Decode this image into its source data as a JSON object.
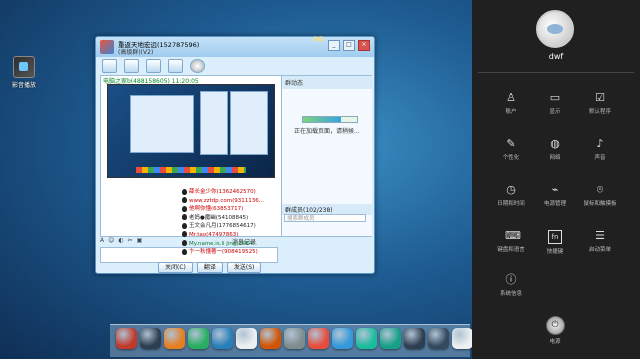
{
  "desktop": {
    "icon_label": "影音播放"
  },
  "chat": {
    "title": "重返天地宏远(152787596)",
    "subtitle": "(高级群)(V2)",
    "qq_badge": "QQ",
    "message_header": "电脑之家b(488158605)  11:20:05",
    "group_header": "群动态",
    "loading_text": "正在加载页面，请稍候...",
    "members_header": "群成员(102/238)",
    "members_search_placeholder": "搜索群成员",
    "members": [
      "薛长金少你(1362462570)",
      "www.zztdp.com(9311136...",
      "他啊你懂(63853717)",
      "老妈●魔幽(54108845)",
      "王文会凡月(1776854617)",
      "Mr.tao(47497863)",
      "My.name.is.li jing(2684...",
      "卞一秋懂著一(908419525)"
    ],
    "input_toolbar": [
      "A",
      "☺",
      "◐",
      "✂",
      "▣"
    ],
    "history_label": "消息记录",
    "buttons": {
      "close": "关闭(C)",
      "translate": "翻译",
      "send": "发送(S)"
    }
  },
  "settings": {
    "user_name": "dwf",
    "items": [
      {
        "label": "账户",
        "icon": "user-icon"
      },
      {
        "label": "显示",
        "icon": "monitor-icon"
      },
      {
        "label": "默认程序",
        "icon": "checkbox-icon"
      },
      {
        "label": "个性化",
        "icon": "brush-icon"
      },
      {
        "label": "网络",
        "icon": "globe-icon"
      },
      {
        "label": "声音",
        "icon": "speaker-icon"
      },
      {
        "label": "日期和时间",
        "icon": "clock-icon"
      },
      {
        "label": "电源管理",
        "icon": "plug-icon"
      },
      {
        "label": "鼠标和触摸板",
        "icon": "mouse-icon"
      },
      {
        "label": "键盘和语言",
        "icon": "keyboard-icon"
      },
      {
        "label": "快捷键",
        "icon": "fn-key-icon"
      },
      {
        "label": "启动菜单",
        "icon": "startup-icon"
      },
      {
        "label": "系统信息",
        "icon": "info-icon"
      }
    ],
    "power_label": "电源"
  },
  "dock": {
    "icon_colors": [
      "#c0392b",
      "#2c3e50",
      "#e67e22",
      "#27ae60",
      "#2980b9",
      "#ecf0f1",
      "#d35400",
      "#7f8c8d",
      "#e74c3c",
      "#3498db",
      "#1abc9c",
      "#16a085",
      "#2c3e50",
      "#34495e",
      "#ecf0f1"
    ]
  }
}
